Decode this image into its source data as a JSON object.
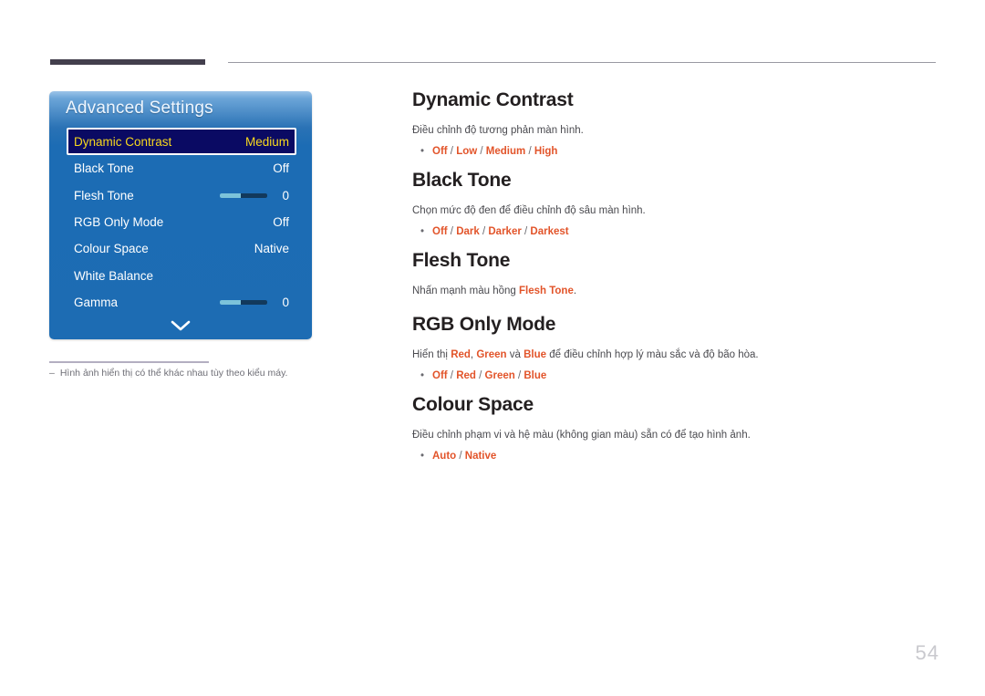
{
  "header": {
    "rule_left_name": "thick-rule",
    "rule_right_name": "thin-rule"
  },
  "osd": {
    "title": "Advanced Settings",
    "scroll_icon": "chevron-down-icon",
    "items": [
      {
        "label": "Dynamic Contrast",
        "value": "Medium",
        "type": "value",
        "selected": true
      },
      {
        "label": "Black Tone",
        "value": "Off",
        "type": "value",
        "selected": false
      },
      {
        "label": "Flesh Tone",
        "value": "0",
        "type": "slider",
        "selected": false
      },
      {
        "label": "RGB Only Mode",
        "value": "Off",
        "type": "value",
        "selected": false
      },
      {
        "label": "Colour Space",
        "value": "Native",
        "type": "value",
        "selected": false
      },
      {
        "label": "White Balance",
        "value": "",
        "type": "value",
        "selected": false
      },
      {
        "label": "Gamma",
        "value": "0",
        "type": "slider",
        "selected": false
      }
    ]
  },
  "note": {
    "dash": "‒",
    "text": "Hình ảnh hiển thị có thể khác nhau tùy theo kiểu máy."
  },
  "content": {
    "bullet": "•",
    "sections": [
      {
        "heading": "Dynamic Contrast",
        "desc": "Điều chỉnh độ tương phản màn hình.",
        "desc_parts": null,
        "options": [
          "Off",
          "Low",
          "Medium",
          "High"
        ]
      },
      {
        "heading": "Black Tone",
        "desc": "Chọn mức độ đen để điều chỉnh độ sâu màn hình.",
        "desc_parts": null,
        "options": [
          "Off",
          "Dark",
          "Darker",
          "Darkest"
        ]
      },
      {
        "heading": "Flesh Tone",
        "desc": "Nhấn mạnh màu hồng Flesh Tone.",
        "desc_parts": [
          {
            "t": "Nhấn mạnh màu hồng ",
            "hl": false
          },
          {
            "t": "Flesh Tone",
            "hl": true
          },
          {
            "t": ".",
            "hl": false
          }
        ],
        "options": []
      },
      {
        "heading": "RGB Only Mode",
        "desc": "Hiển thị Red, Green và Blue để điều chỉnh hợp lý màu sắc và độ bão hòa.",
        "desc_parts": [
          {
            "t": "Hiển thị ",
            "hl": false
          },
          {
            "t": "Red",
            "hl": true
          },
          {
            "t": ", ",
            "hl": false
          },
          {
            "t": "Green",
            "hl": true
          },
          {
            "t": " và ",
            "hl": false
          },
          {
            "t": "Blue",
            "hl": true
          },
          {
            "t": " để điều chỉnh hợp lý màu sắc và độ bão hòa.",
            "hl": false
          }
        ],
        "options": [
          "Off",
          "Red",
          "Green",
          "Blue"
        ]
      },
      {
        "heading": "Colour Space",
        "desc": "Điều chỉnh phạm vi và hệ màu (không gian màu) sẵn có để tạo hình ảnh.",
        "desc_parts": null,
        "options": [
          "Auto",
          "Native"
        ]
      }
    ]
  },
  "page_number": "54",
  "colors": {
    "accent_orange": "#e2542a",
    "osd_blue": "#1d6cb3",
    "osd_selected_bg": "#0a0a63",
    "osd_selected_text": "#f7d81e",
    "rule_dark": "#433f4d",
    "page_number_gray": "#c9c9ce"
  }
}
